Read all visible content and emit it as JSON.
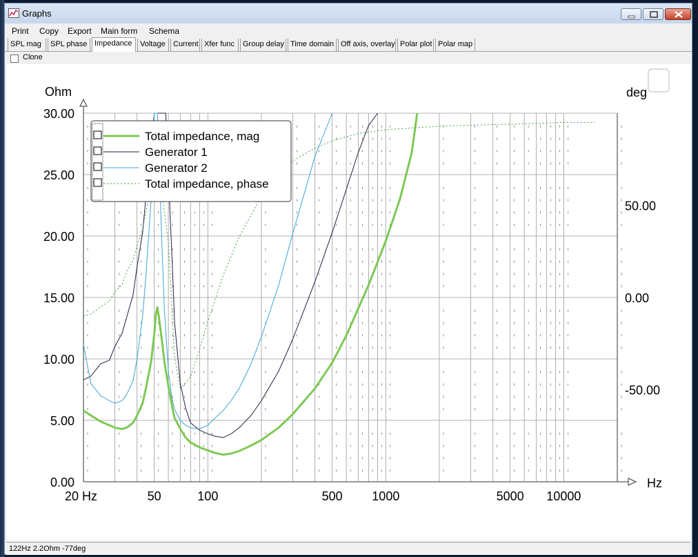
{
  "window": {
    "title": "Graphs"
  },
  "menu": [
    "Print",
    "Copy",
    "Export",
    "Main form",
    "Schema"
  ],
  "tabs": [
    "SPL mag",
    "SPL phase",
    "Impedance",
    "Voltage",
    "Current",
    "Xfer func",
    "Group delay",
    "Time domain",
    "Off axis, overlay",
    "Polar plot",
    "Polar map"
  ],
  "active_tab": "Impedance",
  "clone": {
    "label": "Clone",
    "checked": false
  },
  "status": "122Hz 2.2Ohm -77deg",
  "colors": {
    "mag": "#7ec855",
    "gen1": "#2a1840",
    "gen2": "#3aa5d8",
    "phase": "#3f9a3f",
    "grid": "#9a9a9a"
  },
  "chart_data": {
    "type": "line",
    "x_scale": "log",
    "xlim": [
      20,
      20000
    ],
    "ylim": [
      0,
      30
    ],
    "y2lim": [
      -100,
      100
    ],
    "ylabel": "Ohm",
    "y2label": "deg",
    "xlabel": "Hz",
    "x_ticks": [
      {
        "value": 20,
        "label": "20 Hz"
      },
      {
        "value": 50,
        "label": "50"
      },
      {
        "value": 100,
        "label": "100"
      },
      {
        "value": 500,
        "label": "500"
      },
      {
        "value": 1000,
        "label": "1000"
      },
      {
        "value": 5000,
        "label": "5000"
      },
      {
        "value": 10000,
        "label": "10000"
      }
    ],
    "y_ticks": [
      "0.00",
      "5.00",
      "10.00",
      "15.00",
      "20.00",
      "25.00",
      "30.00"
    ],
    "y2_ticks": [
      "-50.00",
      "0.00",
      "50.00"
    ],
    "legend_position": "top-left",
    "series": [
      {
        "name": "Total impedance, mag",
        "axis": "left",
        "style": "thick",
        "x": [
          20,
          22,
          25,
          28,
          30,
          33,
          35,
          38,
          40,
          43,
          45,
          48,
          50,
          51,
          52,
          53,
          55,
          57,
          60,
          63,
          65,
          70,
          75,
          80,
          90,
          100,
          110,
          122,
          135,
          150,
          175,
          200,
          250,
          300,
          400,
          500,
          600,
          700,
          800,
          900,
          1000,
          1200,
          1400,
          1500
        ],
        "y": [
          5.8,
          5.4,
          4.9,
          4.6,
          4.4,
          4.3,
          4.4,
          4.8,
          5.4,
          6.4,
          7.7,
          9.8,
          12.0,
          13.6,
          14.2,
          13.5,
          11.7,
          9.8,
          7.8,
          6.1,
          5.2,
          4.3,
          3.6,
          3.2,
          2.8,
          2.55,
          2.35,
          2.2,
          2.3,
          2.5,
          2.95,
          3.4,
          4.4,
          5.5,
          7.6,
          9.7,
          11.9,
          14.1,
          16.0,
          17.9,
          19.6,
          23.0,
          26.8,
          30.0
        ]
      },
      {
        "name": "Generator 1",
        "axis": "left",
        "style": "thin",
        "x": [
          20,
          22,
          25,
          28,
          30,
          33,
          35,
          38,
          40,
          43,
          45,
          48,
          50,
          52,
          55,
          58,
          60,
          63,
          65,
          70,
          75,
          80,
          90,
          100,
          110,
          122,
          135,
          150,
          175,
          200,
          250,
          300,
          400,
          500,
          600,
          700,
          800,
          900
        ],
        "y": [
          8.3,
          8.6,
          9.6,
          9.9,
          11.0,
          12.1,
          13.4,
          15.2,
          17.5,
          20.3,
          23.4,
          27.5,
          30.0,
          30.0,
          30.0,
          30.0,
          25.0,
          18.0,
          13.0,
          8.0,
          6.0,
          4.8,
          4.2,
          3.9,
          3.7,
          3.6,
          3.9,
          4.4,
          5.4,
          6.6,
          9.0,
          11.6,
          16.3,
          20.3,
          23.8,
          26.8,
          29.0,
          30.0
        ]
      },
      {
        "name": "Generator 2",
        "axis": "left",
        "style": "thin",
        "x": [
          20,
          22,
          25,
          28,
          30,
          33,
          35,
          38,
          40,
          43,
          45,
          48,
          50,
          51,
          52,
          53,
          55,
          57,
          60,
          63,
          65,
          70,
          75,
          80,
          90,
          100,
          110,
          122,
          135,
          150,
          175,
          200,
          250,
          300,
          400,
          500
        ],
        "y": [
          11.2,
          8.0,
          7.0,
          6.6,
          6.4,
          6.6,
          7.1,
          8.2,
          10.0,
          13.5,
          17.0,
          23.0,
          30.0,
          30.0,
          30.0,
          27.0,
          20.0,
          14.0,
          9.0,
          6.7,
          5.9,
          5.0,
          4.6,
          4.4,
          4.3,
          4.6,
          5.2,
          5.8,
          6.6,
          7.6,
          9.6,
          11.8,
          16.0,
          20.2,
          26.5,
          30.0
        ]
      },
      {
        "name": "Total impedance, phase",
        "axis": "right",
        "style": "dotted",
        "x": [
          20,
          22,
          25,
          28,
          30,
          33,
          35,
          38,
          40,
          43,
          45,
          48,
          50,
          53,
          55,
          60,
          65,
          70,
          80,
          90,
          100,
          122,
          150,
          200,
          250,
          300,
          400,
          500,
          700,
          1000,
          2000,
          5000,
          10000,
          15000
        ],
        "y": [
          -10,
          -9,
          -5,
          -2,
          3,
          7,
          14,
          20,
          28,
          37,
          47,
          60,
          64,
          62,
          58,
          30,
          -32,
          -50,
          -43,
          -28,
          -13,
          12,
          33,
          55,
          67,
          74,
          81,
          85,
          89,
          91,
          93,
          94,
          95,
          95
        ]
      }
    ]
  }
}
